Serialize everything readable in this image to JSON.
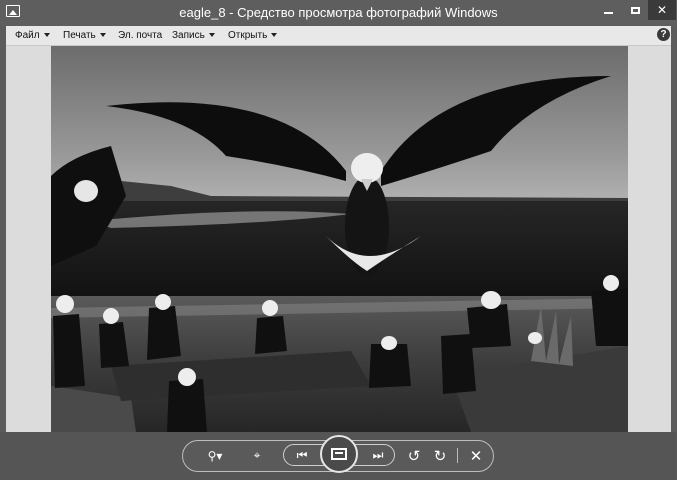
{
  "window": {
    "title": "eagle_8 - Средство просмотра фотографий Windows",
    "minimize_icon": "minimize-icon",
    "maximize_icon": "maximize-icon",
    "close_glyph": "✕"
  },
  "menu": {
    "items": [
      {
        "label": "Файл",
        "has_dropdown": true
      },
      {
        "label": "Печать",
        "has_dropdown": true
      },
      {
        "label": "Эл. почта",
        "has_dropdown": false
      },
      {
        "label": "Запись",
        "has_dropdown": true
      },
      {
        "label": "Открыть",
        "has_dropdown": true
      }
    ],
    "help_glyph": "?"
  },
  "photo": {
    "subject": "bald eagles on shore"
  },
  "toolbar": {
    "zoom_glyph": "⚲▾",
    "actual_size_glyph": "⌖",
    "prev_glyph": "⏮",
    "next_glyph": "⏭",
    "rotate_left_glyph": "↺",
    "rotate_right_glyph": "↻",
    "delete_glyph": "✕"
  },
  "colors": {
    "chrome": "#5c5c5c",
    "menubar": "#e8e8e8",
    "viewer_bg": "#dcdcdc"
  }
}
